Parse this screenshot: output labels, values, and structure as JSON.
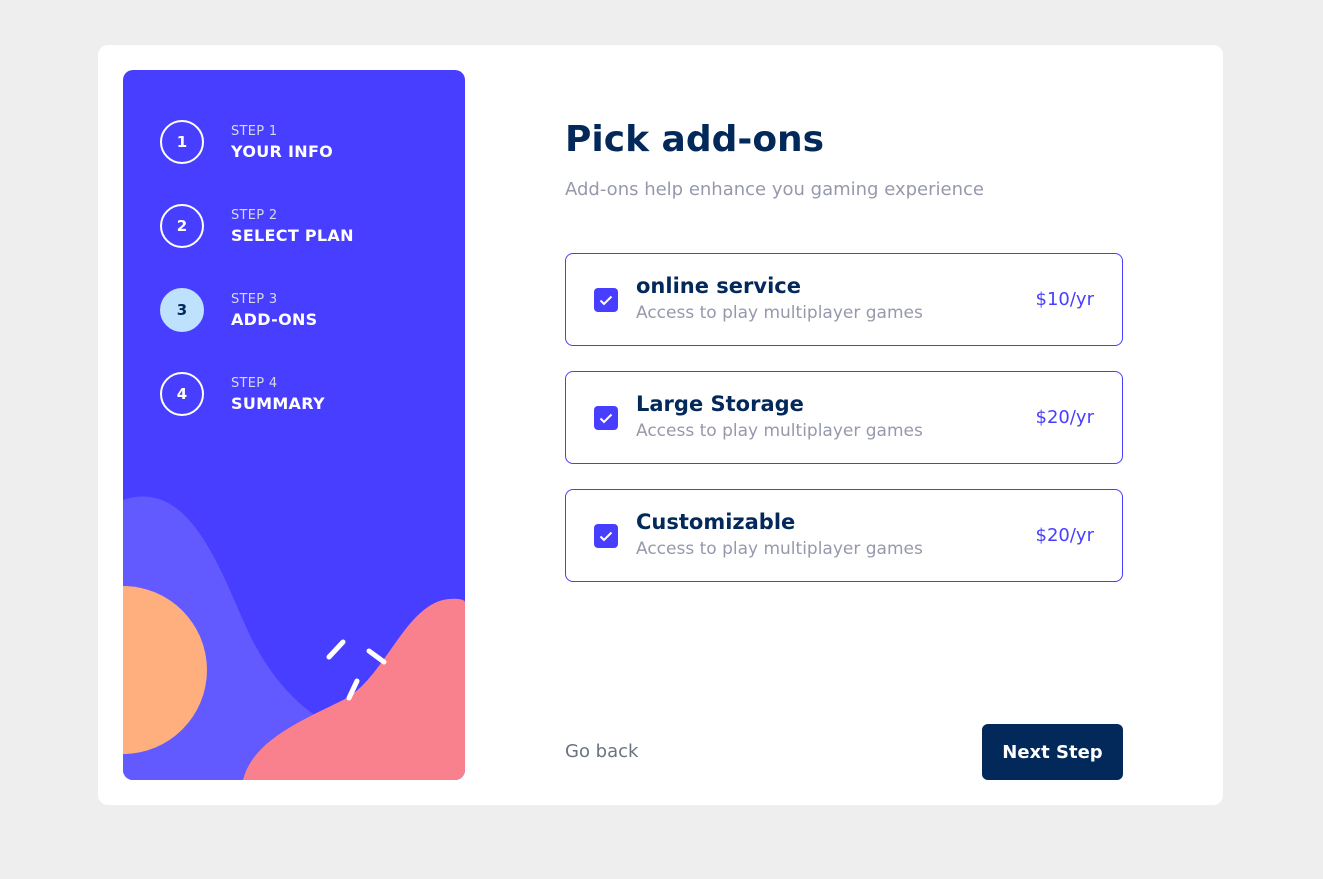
{
  "colors": {
    "primary": "#483eff",
    "marine": "#02295a",
    "active_step": "#bee2fd",
    "gray": "#9699ab",
    "page_bg": "#eeeeee",
    "deco_purple": "#6259ff",
    "deco_orange": "#ffaf7e",
    "deco_pink": "#f9818e"
  },
  "sidebar": {
    "steps": [
      {
        "number": "1",
        "kicker": "STEP 1",
        "title": "YOUR INFO",
        "active": false
      },
      {
        "number": "2",
        "kicker": "STEP 2",
        "title": "SELECT PLAN",
        "active": false
      },
      {
        "number": "3",
        "kicker": "STEP 3",
        "title": "ADD-ONS",
        "active": true
      },
      {
        "number": "4",
        "kicker": "STEP 4",
        "title": "SUMMARY",
        "active": false
      }
    ]
  },
  "main": {
    "title": "Pick add-ons",
    "subtitle": "Add-ons help enhance you gaming experience",
    "addons": [
      {
        "name": "online service",
        "description": "Access to play multiplayer games",
        "price": "$10/yr",
        "checked": true,
        "icon": "checkmark-icon"
      },
      {
        "name": "Large Storage",
        "description": "Access to play multiplayer games",
        "price": "$20/yr",
        "checked": true,
        "icon": "checkmark-icon"
      },
      {
        "name": "Customizable",
        "description": "Access to play multiplayer games",
        "price": "$20/yr",
        "checked": true,
        "icon": "checkmark-icon"
      }
    ],
    "go_back_label": "Go back",
    "next_label": "Next Step"
  }
}
